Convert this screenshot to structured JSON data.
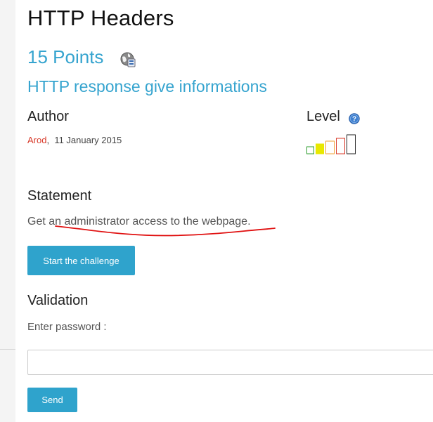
{
  "challenge": {
    "title": "HTTP Headers",
    "points": "15 Points",
    "points_icon": "globe-icon",
    "subtitle": "HTTP response give informations"
  },
  "author": {
    "heading": "Author",
    "name": "Arod",
    "separator": ",",
    "date": "11 January 2015",
    "name_color": "#d83a2a"
  },
  "level": {
    "heading": "Level",
    "help_icon": "help-icon",
    "value": 2,
    "max": 5,
    "bar_colors": [
      "#2e9c2e",
      "#e8e800",
      "#f0a030",
      "#d83a2a",
      "#222222"
    ]
  },
  "statement": {
    "heading": "Statement",
    "text": "Get an administrator access to the webpage."
  },
  "actions": {
    "start_label": "Start the challenge",
    "send_label": "Send"
  },
  "validation": {
    "heading": "Validation",
    "password_label": "Enter password :",
    "password_value": "",
    "password_placeholder": ""
  },
  "colors": {
    "accent": "#36a4cf",
    "button": "#2fa3cc"
  }
}
